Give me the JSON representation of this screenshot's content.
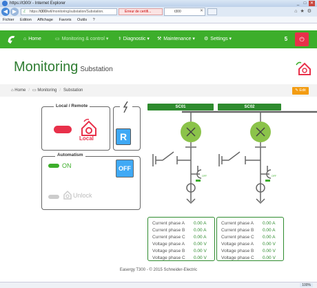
{
  "window": {
    "title": "https://t300/ - Internet Explorer",
    "address_prefix": "https://",
    "address_host": "t300",
    "address_path": "/wtl/monitoring/substation/Substation.",
    "cert_error": "Erreur de certifi...",
    "tab_title": "t300"
  },
  "menu": [
    "Fichier",
    "Edition",
    "Affichage",
    "Favoris",
    "Outils",
    "?"
  ],
  "nav": {
    "items": [
      {
        "label": "Home",
        "icon": "home-icon"
      },
      {
        "label": "Monitoring & control",
        "icon": "monitor-icon",
        "active": true
      },
      {
        "label": "Diagnostic",
        "icon": "stethoscope-icon"
      },
      {
        "label": "Maintenance",
        "icon": "tools-icon"
      },
      {
        "label": "Settings",
        "icon": "gears-icon"
      }
    ],
    "counter": "5"
  },
  "header": {
    "title": "Monitoring",
    "subtitle": "Substation"
  },
  "breadcrumb": [
    "Home",
    "Monitoring",
    "Substation"
  ],
  "edit_label": "Edit",
  "local_remote": {
    "title": "Local / Remote",
    "mode": "Local",
    "button": "R"
  },
  "automatism": {
    "title": "Automatism",
    "state": "ON",
    "button": "OFF",
    "unlock": "Unlock"
  },
  "feeders": [
    {
      "name": "SC01",
      "earth_state": "OFF",
      "measurements": [
        {
          "label": "Current phase A",
          "value": "0.00 A"
        },
        {
          "label": "Current phase B",
          "value": "0.00 A"
        },
        {
          "label": "Current phase C",
          "value": "0.00 A"
        },
        {
          "label": "Voltage phase A",
          "value": "0.00 V"
        },
        {
          "label": "Voltage phase B",
          "value": "0.00 V"
        },
        {
          "label": "Voltage phase C",
          "value": "0.00 V"
        }
      ]
    },
    {
      "name": "SC02",
      "earth_state": "OFF",
      "measurements": [
        {
          "label": "Current phase A",
          "value": "0.00 A"
        },
        {
          "label": "Current phase B",
          "value": "0.00 A"
        },
        {
          "label": "Current phase C",
          "value": "0.00 A"
        },
        {
          "label": "Voltage phase A",
          "value": "0.00 V"
        },
        {
          "label": "Voltage phase B",
          "value": "0.00 V"
        },
        {
          "label": "Voltage phase C",
          "value": "0.00 V"
        }
      ]
    }
  ],
  "footer": "Easergy T300 - © 2015 Schneider-Electric",
  "zoom": "100%",
  "colors": {
    "brand_green": "#3dae2b",
    "dark_green": "#2e8b2e",
    "red": "#e8304a",
    "blue": "#3fa9f5",
    "orange": "#f39c12"
  }
}
